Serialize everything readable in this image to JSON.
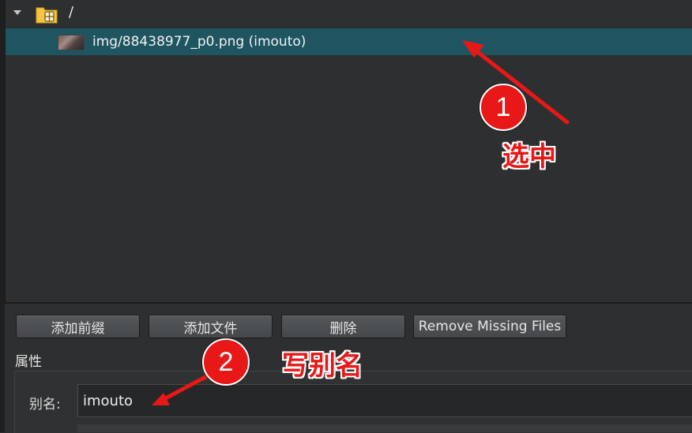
{
  "tree": {
    "root": {
      "label": "/",
      "icon": "folder-package-icon"
    },
    "file": {
      "label": "img/88438977_p0.png (imouto)",
      "icon": "image-thumbnail"
    }
  },
  "buttons": {
    "add_prefix": "添加前缀",
    "add_file": "添加文件",
    "delete": "删除",
    "remove_missing": "Remove Missing Files"
  },
  "properties": {
    "title": "属性",
    "alias_label": "别名:",
    "alias_value": "imouto"
  },
  "annotations": {
    "step1_number": "1",
    "step1_text": "选中",
    "step2_number": "2",
    "step2_text": "写别名",
    "color": "#e81818"
  },
  "colors": {
    "selection": "#1f5561",
    "background": "#2e2f30"
  }
}
